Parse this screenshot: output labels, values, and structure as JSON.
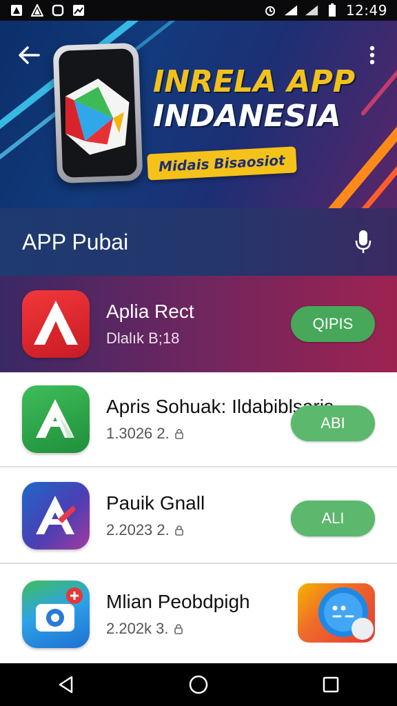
{
  "status_bar": {
    "time": "12:49"
  },
  "hero": {
    "title_line1": "INRELA APP",
    "title_line2": "INDANESIA",
    "tag": "Midais Bisaosiot"
  },
  "search": {
    "value": "APP Pubai"
  },
  "featured": {
    "name": "Aplia Rect",
    "meta": "Dlalık B;18",
    "action": "QIPIS"
  },
  "apps": [
    {
      "name": "Apris Sohuak: Ildabiblsaris",
      "meta": "1.3026 2.",
      "action": "ABI"
    },
    {
      "name": "Pauik Gnall",
      "meta": "2.2023 2.",
      "action": "ALI"
    },
    {
      "name": "Mlian Peobdpigh",
      "meta": "2.202k 3.",
      "action": ""
    }
  ],
  "colors": {
    "accent_green": "#47a85a",
    "hero_yellow": "#f2c21b",
    "featured_gradient_start": "#3a2864",
    "featured_gradient_end": "#9d2350"
  }
}
